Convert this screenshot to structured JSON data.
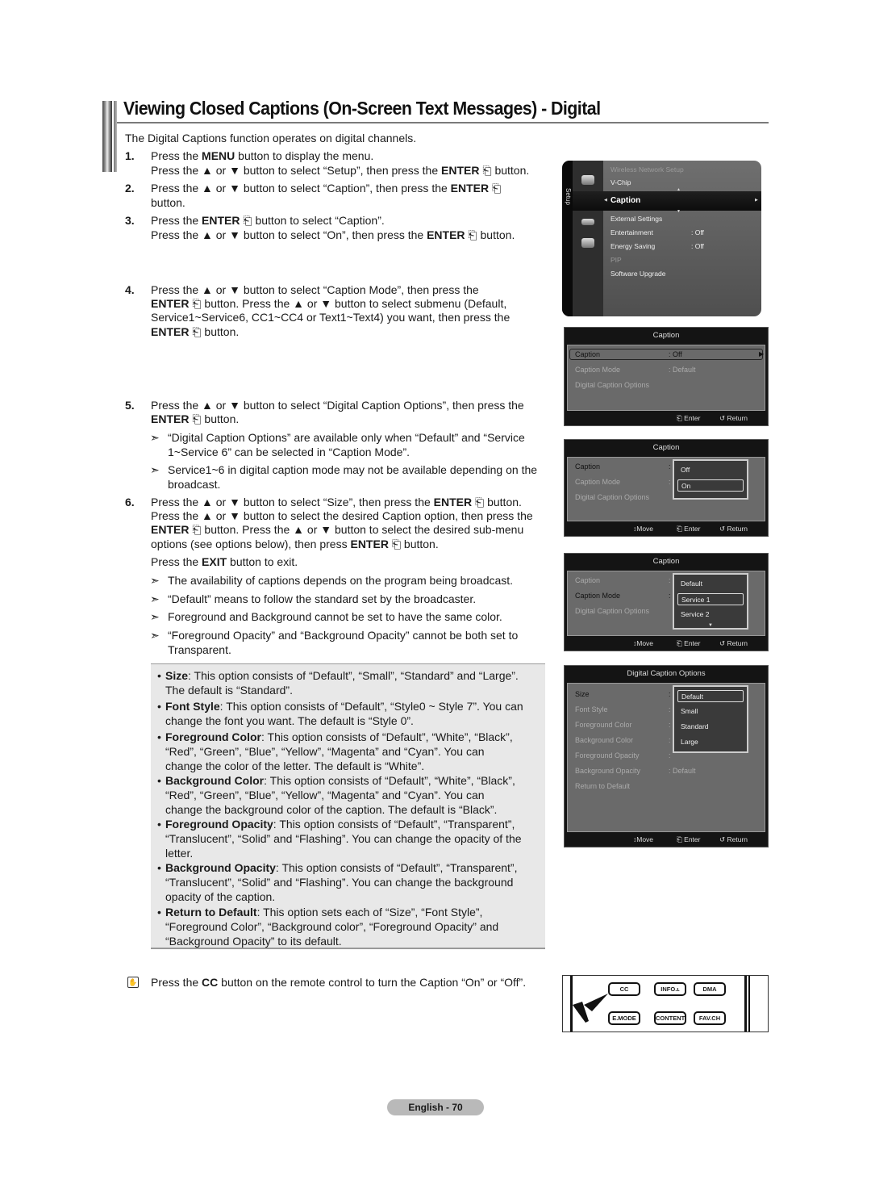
{
  "title": "Viewing Closed Captions (On-Screen Text Messages) - Digital",
  "intro": "The Digital Captions function operates on digital channels.",
  "steps": [
    {
      "num": "1.",
      "lines": [
        [
          "Press the ",
          {
            "b": "MENU"
          },
          " button to display the menu."
        ],
        [
          "Press the ▲ or ▼ button to select “Setup”, then press the ",
          {
            "b": "ENTER"
          },
          " ⎗ button."
        ]
      ]
    },
    {
      "num": "2.",
      "lines": [
        [
          "Press the ▲ or ▼ button to select “Caption”, then press the ",
          {
            "b": "ENTER"
          },
          " ⎗"
        ],
        [
          "button."
        ]
      ]
    },
    {
      "num": "3.",
      "lines": [
        [
          "Press the ",
          {
            "b": "ENTER"
          },
          " ⎗ button to select “Caption”."
        ],
        [
          "Press the ▲ or ▼ button to select “On”, then press the ",
          {
            "b": "ENTER"
          },
          " ⎗ button."
        ]
      ]
    },
    {
      "num": "4.",
      "lines": [
        [
          "Press the ▲ or ▼ button to select “Caption Mode”, then press the"
        ],
        [
          {
            "b": "ENTER"
          },
          " ⎗ button. Press the ▲ or ▼ button to select submenu (Default,"
        ],
        [
          "Service1~Service6, CC1~CC4 or Text1~Text4) you want, then press the"
        ],
        [
          {
            "b": "ENTER"
          },
          " ⎗ button."
        ]
      ]
    },
    {
      "num": "5.",
      "lines": [
        [
          "Press the ▲ or ▼ button to select “Digital Caption Options”, then press the"
        ],
        [
          {
            "b": "ENTER"
          },
          " ⎗ button."
        ]
      ]
    },
    {
      "num": "6.",
      "lines": [
        [
          "Press the ▲ or ▼ button to select “Size”, then press the ",
          {
            "b": "ENTER"
          },
          " ⎗ button."
        ],
        [
          "Press the ▲ or ▼ button to select the desired Caption option, then press the"
        ],
        [
          {
            "b": "ENTER"
          },
          " ⎗ button. Press the ▲ or ▼ button to select the desired sub-menu"
        ],
        [
          "options (see options below), then press ",
          {
            "b": "ENTER"
          },
          " ⎗ button."
        ]
      ]
    }
  ],
  "exit_line": [
    "Press the ",
    {
      "b": "EXIT"
    },
    " button to exit."
  ],
  "notes_step5": [
    [
      "“Digital Caption Options” are available only when “Default” and “Service",
      "1~Service 6” can be selected in “Caption Mode”."
    ],
    [
      "Service1~6 in digital caption mode may not be available depending on the",
      "broadcast."
    ]
  ],
  "notes_step6": [
    [
      "The availability of captions depends on the program being broadcast."
    ],
    [
      "“Default” means to follow the standard set by the broadcaster."
    ],
    [
      "Foreground and Background cannot be set to have the same color."
    ],
    [
      "“Foreground Opacity” and “Background Opacity” cannot be both set to",
      "Transparent."
    ]
  ],
  "note_arrow": "➣",
  "options": [
    {
      "term": "Size",
      "lines": [
        ": This option consists of “Default”, “Small”, “Standard” and “Large”.",
        "The default is “Standard”."
      ]
    },
    {
      "term": "Font Style",
      "lines": [
        ": This option consists of “Default”, “Style0 ~ Style 7”. You can",
        "change the font you want. The default is “Style 0”."
      ]
    },
    {
      "term": "Foreground Color",
      "lines": [
        ": This option consists of “Default”, “White”, “Black”,",
        "“Red”, “Green”, “Blue”, “Yellow”, “Magenta” and “Cyan”. You can",
        "change the color of the letter. The default is “White”."
      ]
    },
    {
      "term": "Background Color",
      "lines": [
        ": This option consists of “Default”, “White”, “Black”,",
        "“Red”, “Green”, “Blue”, “Yellow”, “Magenta” and “Cyan”. You can",
        "change the background color of the caption. The default is “Black”."
      ]
    },
    {
      "term": "Foreground Opacity",
      "lines": [
        ": This option consists of “Default”, “Transparent”,",
        "“Translucent”, “Solid” and “Flashing”. You can change the opacity of the",
        "letter."
      ]
    },
    {
      "term": "Background Opacity",
      "lines": [
        ": This option consists of “Default”, “Transparent”,",
        "“Translucent”, “Solid” and “Flashing”. You can change the background",
        "opacity of the caption."
      ]
    },
    {
      "term": "Return to Default",
      "lines": [
        ": This option sets each of “Size”, “Font Style”,",
        "“Foreground Color”, “Background color”, “Foreground Opacity” and",
        "“Background Opacity” to its default."
      ]
    }
  ],
  "memo": {
    "icon": "memo-icon",
    "pre": "Press the ",
    "bold": "CC",
    "post": " button on the remote control to turn the Caption “On” or “Off”."
  },
  "page_label": "English - 70",
  "setup_menu": {
    "tab_label": "Setup",
    "items": [
      {
        "label": "Wireless Network Setup",
        "value": "",
        "dim": true
      },
      {
        "label": "V-Chip",
        "value": "",
        "dim": false
      },
      {
        "label": "Caption",
        "value": "",
        "selected": true
      },
      {
        "label": "External Settings",
        "value": "",
        "dim": false
      },
      {
        "label": "Entertainment",
        "value": ": Off",
        "dim": false
      },
      {
        "label": "Energy Saving",
        "value": ": Off",
        "dim": false
      },
      {
        "label": "PIP",
        "value": "",
        "dim": true
      },
      {
        "label": "Software Upgrade",
        "value": "",
        "dim": false
      }
    ]
  },
  "caption_screens": [
    {
      "title": "Caption",
      "rows": [
        {
          "label": "Caption",
          "value": ": Off",
          "state": "selected"
        },
        {
          "label": "Caption Mode",
          "value": ": Default",
          "state": "dim"
        },
        {
          "label": "Digital Caption Options",
          "value": "",
          "state": "dim"
        }
      ],
      "footer": {
        "move": "",
        "enter": "Enter",
        "return": "Return"
      }
    },
    {
      "title": "Caption",
      "rows": [
        {
          "label": "Caption",
          "value": ":",
          "state": "active"
        },
        {
          "label": "Caption Mode",
          "value": ":",
          "state": "dim"
        },
        {
          "label": "Digital Caption Options",
          "value": "",
          "state": "dim"
        }
      ],
      "popup": {
        "items": [
          "Off",
          "On"
        ],
        "selected": 1
      },
      "footer": {
        "move": "Move",
        "enter": "Enter",
        "return": "Return"
      }
    },
    {
      "title": "Caption",
      "rows": [
        {
          "label": "Caption",
          "value": ":",
          "state": "dim"
        },
        {
          "label": "Caption Mode",
          "value": ":",
          "state": "active"
        },
        {
          "label": "Digital Caption Options",
          "value": "",
          "state": "dim"
        }
      ],
      "popup": {
        "items": [
          "Default",
          "Service 1",
          "Service 2"
        ],
        "selected": 1,
        "more": "▼"
      },
      "footer": {
        "move": "Move",
        "enter": "Enter",
        "return": "Return"
      }
    },
    {
      "title": "Digital Caption Options",
      "rows": [
        {
          "label": "Size",
          "value": ":",
          "state": "active"
        },
        {
          "label": "Font Style",
          "value": ":",
          "state": "dim"
        },
        {
          "label": "Foreground Color",
          "value": ":",
          "state": "dim"
        },
        {
          "label": "Background Color",
          "value": ":",
          "state": "dim"
        },
        {
          "label": "Foreground Opacity",
          "value": ":",
          "state": "dim"
        },
        {
          "label": "Background Opacity",
          "value": ": Default",
          "state": "dim"
        },
        {
          "label": "Return to Default",
          "value": "",
          "state": "dim"
        }
      ],
      "popup": {
        "items": [
          "Default",
          "Small",
          "Standard",
          "Large"
        ],
        "selected": 0
      },
      "footer": {
        "move": "Move",
        "enter": "Enter",
        "return": "Return"
      }
    }
  ],
  "remote": {
    "buttons": [
      [
        "CC",
        "INFO.ʟ",
        "DMA"
      ],
      [
        "E.MODE",
        "CONTENT",
        "FAV.CH"
      ]
    ]
  },
  "colors": {
    "osd_dark": "#141414",
    "osd_body": "#6a6a6a",
    "option_box": "#e8e8e8",
    "page_pill": "#b9b9b9"
  }
}
